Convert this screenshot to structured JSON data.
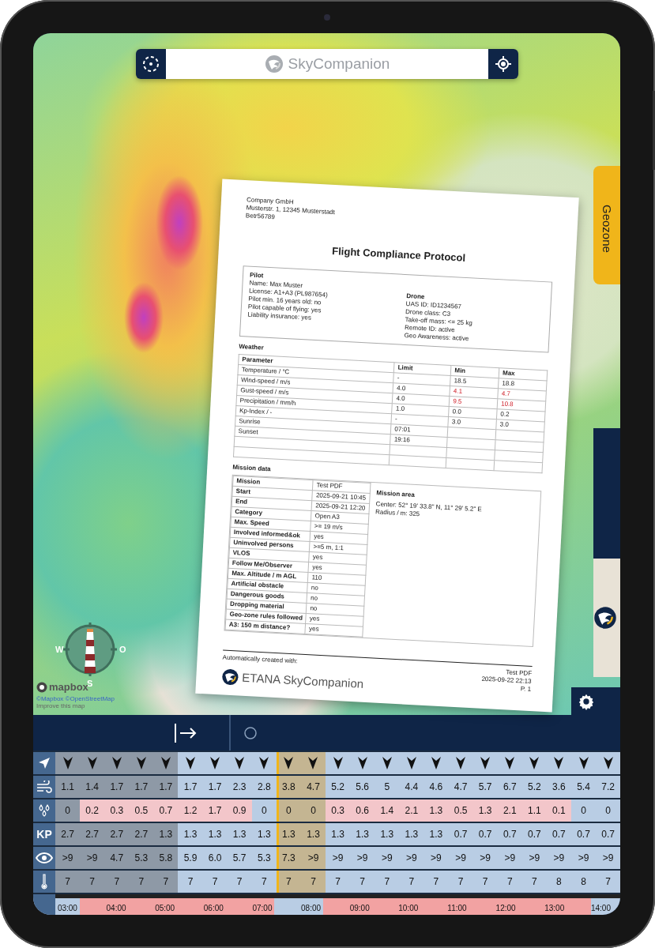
{
  "top_bar": {
    "title": "SkyCompanion"
  },
  "geozone_tab": {
    "label": "Geozone"
  },
  "compass": {
    "west": "W",
    "east": "O",
    "south": "S"
  },
  "attribution": {
    "logo": "mapbox",
    "credits": "©Mapbox ©OpenStreetMap",
    "link": "Improve this map"
  },
  "forecast": {
    "rows": [
      {
        "kind": "direction"
      },
      {
        "kind": "wind"
      },
      {
        "kind": "precipitation"
      },
      {
        "kind": "kp",
        "label": "KP"
      },
      {
        "kind": "visibility"
      },
      {
        "kind": "temperature"
      }
    ],
    "columns": [
      {
        "wind": "1.1",
        "precipitation": "0",
        "precipitation_warning": false,
        "kp": "2.7",
        "visibility": ">9",
        "temperature": "7",
        "night": true,
        "selected": false,
        "now": false,
        "restricted": false
      },
      {
        "wind": "1.4",
        "precipitation": "0.2",
        "precipitation_warning": true,
        "kp": "2.7",
        "visibility": ">9",
        "temperature": "7",
        "night": true,
        "selected": false,
        "now": false,
        "restricted": true
      },
      {
        "wind": "1.7",
        "precipitation": "0.3",
        "precipitation_warning": true,
        "kp": "2.7",
        "visibility": "4.7",
        "temperature": "7",
        "night": true,
        "selected": false,
        "now": false,
        "restricted": true
      },
      {
        "wind": "1.7",
        "precipitation": "0.5",
        "precipitation_warning": true,
        "kp": "2.7",
        "visibility": "5.3",
        "temperature": "7",
        "night": true,
        "selected": false,
        "now": false,
        "restricted": true
      },
      {
        "wind": "1.7",
        "precipitation": "0.7",
        "precipitation_warning": true,
        "kp": "1.3",
        "visibility": "5.8",
        "temperature": "7",
        "night": true,
        "selected": false,
        "now": false,
        "restricted": true
      },
      {
        "wind": "1.7",
        "precipitation": "1.2",
        "precipitation_warning": true,
        "kp": "1.3",
        "visibility": "5.9",
        "temperature": "7",
        "night": false,
        "selected": false,
        "now": false,
        "restricted": true
      },
      {
        "wind": "1.7",
        "precipitation": "1.7",
        "precipitation_warning": true,
        "kp": "1.3",
        "visibility": "6.0",
        "temperature": "7",
        "night": false,
        "selected": false,
        "now": false,
        "restricted": true
      },
      {
        "wind": "2.3",
        "precipitation": "0.9",
        "precipitation_warning": true,
        "kp": "1.3",
        "visibility": "5.7",
        "temperature": "7",
        "night": false,
        "selected": false,
        "now": false,
        "restricted": true
      },
      {
        "wind": "2.8",
        "precipitation": "0",
        "precipitation_warning": false,
        "kp": "1.3",
        "visibility": "5.3",
        "temperature": "7",
        "night": false,
        "selected": false,
        "now": false,
        "restricted": true
      },
      {
        "wind": "3.8",
        "precipitation": "0",
        "precipitation_warning": false,
        "kp": "1.3",
        "visibility": "7.3",
        "temperature": "7",
        "night": false,
        "selected": true,
        "now": true,
        "restricted": false
      },
      {
        "wind": "4.7",
        "precipitation": "0",
        "precipitation_warning": false,
        "kp": "1.3",
        "visibility": ">9",
        "temperature": "7",
        "night": false,
        "selected": true,
        "now": false,
        "restricted": false
      },
      {
        "wind": "5.2",
        "precipitation": "0.3",
        "precipitation_warning": true,
        "kp": "1.3",
        "visibility": ">9",
        "temperature": "7",
        "night": false,
        "selected": false,
        "now": false,
        "restricted": true
      },
      {
        "wind": "5.6",
        "precipitation": "0.6",
        "precipitation_warning": true,
        "kp": "1.3",
        "visibility": ">9",
        "temperature": "7",
        "night": false,
        "selected": false,
        "now": false,
        "restricted": true
      },
      {
        "wind": "5",
        "precipitation": "1.4",
        "precipitation_warning": true,
        "kp": "1.3",
        "visibility": ">9",
        "temperature": "7",
        "night": false,
        "selected": false,
        "now": false,
        "restricted": true
      },
      {
        "wind": "4.4",
        "precipitation": "2.1",
        "precipitation_warning": true,
        "kp": "1.3",
        "visibility": ">9",
        "temperature": "7",
        "night": false,
        "selected": false,
        "now": false,
        "restricted": true
      },
      {
        "wind": "4.6",
        "precipitation": "1.3",
        "precipitation_warning": true,
        "kp": "1.3",
        "visibility": ">9",
        "temperature": "7",
        "night": false,
        "selected": false,
        "now": false,
        "restricted": true
      },
      {
        "wind": "4.7",
        "precipitation": "0.5",
        "precipitation_warning": true,
        "kp": "0.7",
        "visibility": ">9",
        "temperature": "7",
        "night": false,
        "selected": false,
        "now": false,
        "restricted": true
      },
      {
        "wind": "5.7",
        "precipitation": "1.3",
        "precipitation_warning": true,
        "kp": "0.7",
        "visibility": ">9",
        "temperature": "7",
        "night": false,
        "selected": false,
        "now": false,
        "restricted": true
      },
      {
        "wind": "6.7",
        "precipitation": "2.1",
        "precipitation_warning": true,
        "kp": "0.7",
        "visibility": ">9",
        "temperature": "7",
        "night": false,
        "selected": false,
        "now": false,
        "restricted": true
      },
      {
        "wind": "5.2",
        "precipitation": "1.1",
        "precipitation_warning": true,
        "kp": "0.7",
        "visibility": ">9",
        "temperature": "7",
        "night": false,
        "selected": false,
        "now": false,
        "restricted": true
      },
      {
        "wind": "3.6",
        "precipitation": "0.1",
        "precipitation_warning": true,
        "kp": "0.7",
        "visibility": ">9",
        "temperature": "8",
        "night": false,
        "selected": false,
        "now": false,
        "restricted": true
      },
      {
        "wind": "5.4",
        "precipitation": "0",
        "precipitation_warning": false,
        "kp": "0.7",
        "visibility": ">9",
        "temperature": "8",
        "night": false,
        "selected": false,
        "now": false,
        "restricted": true
      },
      {
        "wind": "7.2",
        "precipitation": "0",
        "precipitation_warning": false,
        "kp": "0.7",
        "visibility": ">9",
        "temperature": "7",
        "night": false,
        "selected": false,
        "now": false,
        "restricted": false
      }
    ],
    "hours": [
      "03:00",
      "04:00",
      "05:00",
      "06:00",
      "07:00",
      "08:00",
      "09:00",
      "10:00",
      "11:00",
      "12:00",
      "13:00",
      "14:00"
    ]
  },
  "document": {
    "sender": [
      "Company GmbH",
      "Musterstr. 1, 12345 Musterstadt",
      "Betr56789"
    ],
    "title": "Flight Compliance Protocol",
    "pilot": {
      "heading": "Pilot",
      "lines": [
        "Name: Max Muster",
        "License: A1+A3 (PL987654)",
        "Pilot min. 16 years old: no",
        "Pilot capable of flying: yes",
        "Liability insurance: yes"
      ]
    },
    "drone": {
      "heading": "Drone",
      "lines": [
        "UAS ID: ID1234567",
        "Drone class: C3",
        "Take-off mass: <= 25 kg",
        "Remote ID: active",
        "Geo Awareness: active"
      ]
    },
    "weather": {
      "heading": "Weather",
      "columns": [
        "Parameter",
        "Limit",
        "Min",
        "Max"
      ],
      "rows": [
        {
          "parameter": "Temperature / °C",
          "limit": "-",
          "min": "18.5",
          "min_exceeded": false,
          "max": "18.8",
          "max_exceeded": false
        },
        {
          "parameter": "Wind-speed / m/s",
          "limit": "4.0",
          "min": "4.1",
          "min_exceeded": true,
          "max": "4.7",
          "max_exceeded": true
        },
        {
          "parameter": "Gust-speed / m/s",
          "limit": "4.0",
          "min": "9.5",
          "min_exceeded": true,
          "max": "10.8",
          "max_exceeded": true
        },
        {
          "parameter": "Precipitation / mm/h",
          "limit": "1.0",
          "min": "0.0",
          "min_exceeded": false,
          "max": "0.2",
          "max_exceeded": false
        },
        {
          "parameter": "Kp-Index / -",
          "limit": "-",
          "min": "3.0",
          "min_exceeded": false,
          "max": "3.0",
          "max_exceeded": false
        },
        {
          "parameter": "Sunrise",
          "limit": "07:01"
        },
        {
          "parameter": "Sunset",
          "limit": "19:16"
        }
      ]
    },
    "mission": {
      "heading": "Mission data",
      "rows": [
        {
          "label": "Mission",
          "value": "Test PDF"
        },
        {
          "label": "Start",
          "value": "2025-09-21 10:45"
        },
        {
          "label": "End",
          "value": "2025-09-21 12:20"
        },
        {
          "label": "Category",
          "value": "Open A3"
        },
        {
          "label": "Max. Speed",
          "value": ">= 19 m/s"
        },
        {
          "label": "Involved informed&ok",
          "value": "yes"
        },
        {
          "label": "Uninvolved persons",
          "value": ">=5 m, 1:1"
        },
        {
          "label": "VLOS",
          "value": "yes"
        },
        {
          "label": "Follow Me/Observer",
          "value": "yes"
        },
        {
          "label": "Max. Altitude / m AGL",
          "value": "110"
        },
        {
          "label": "Artificial obstacle",
          "value": "no"
        },
        {
          "label": "Dangerous goods",
          "value": "no"
        },
        {
          "label": "Dropping material",
          "value": "no"
        },
        {
          "label": "Geo-zone rules followed",
          "value": "yes"
        },
        {
          "label": "A3: 150 m distance?",
          "value": "yes"
        }
      ],
      "area": {
        "heading": "Mission area",
        "lines": [
          "Center: 52° 19' 33.8\" N, 11° 29' 5.2\" E",
          "Radius / m: 325"
        ]
      }
    },
    "footer": {
      "created": "Automatically created with:",
      "brand": "ETANA SkyCompanion",
      "name": "Test PDF",
      "date": "2025-09-22 22:13",
      "page": "P. 1"
    }
  }
}
